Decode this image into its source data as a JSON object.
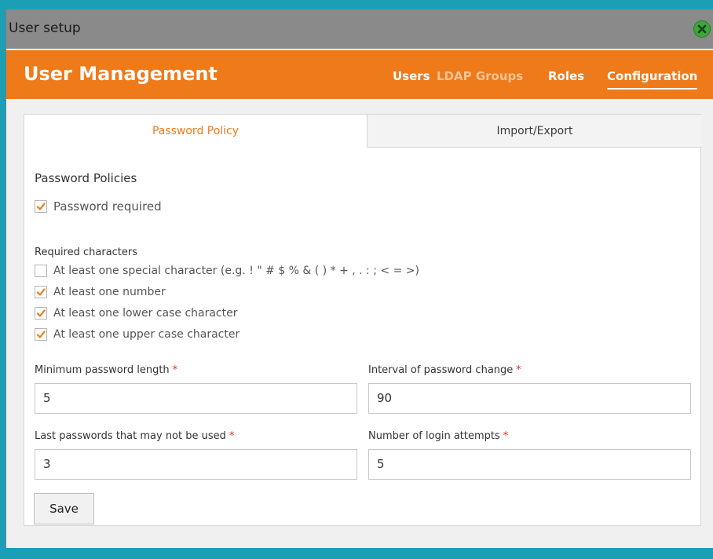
{
  "window": {
    "title": "User setup"
  },
  "header": {
    "title": "User Management",
    "nav": [
      {
        "label": "Users"
      },
      {
        "label": "LDAP Groups"
      },
      {
        "label": "Roles"
      },
      {
        "label": "Configuration"
      }
    ]
  },
  "tabs": [
    {
      "label": "Password Policy",
      "active": true
    },
    {
      "label": "Import/Export",
      "active": false
    }
  ],
  "policy": {
    "section_title": "Password Policies",
    "password_required": {
      "label": "Password required",
      "checked": true
    },
    "required_chars_title": "Required characters",
    "required_chars": [
      {
        "label": "At least one special character (e.g. ! \" # $ % & ( ) * + , . : ; < = >)",
        "checked": false
      },
      {
        "label": "At least one number",
        "checked": true
      },
      {
        "label": "At least one lower case character",
        "checked": true
      },
      {
        "label": "At least one upper case character",
        "checked": true
      }
    ]
  },
  "fields": {
    "min_length": {
      "label": "Minimum password length",
      "value": "5",
      "required_mark": "*"
    },
    "interval": {
      "label": "Interval of password change",
      "value": "90",
      "required_mark": "*"
    },
    "last_passwords": {
      "label": "Last passwords that may not be used",
      "value": "3",
      "required_mark": "*"
    },
    "login_attempts": {
      "label": "Number of login attempts",
      "value": "5",
      "required_mark": "*"
    }
  },
  "buttons": {
    "save_label": "Save"
  },
  "colors": {
    "accent": "#ee7a1a",
    "frame": "#1a9fb7",
    "checkmark": "#ee7a1a",
    "required": "#e0301e"
  }
}
